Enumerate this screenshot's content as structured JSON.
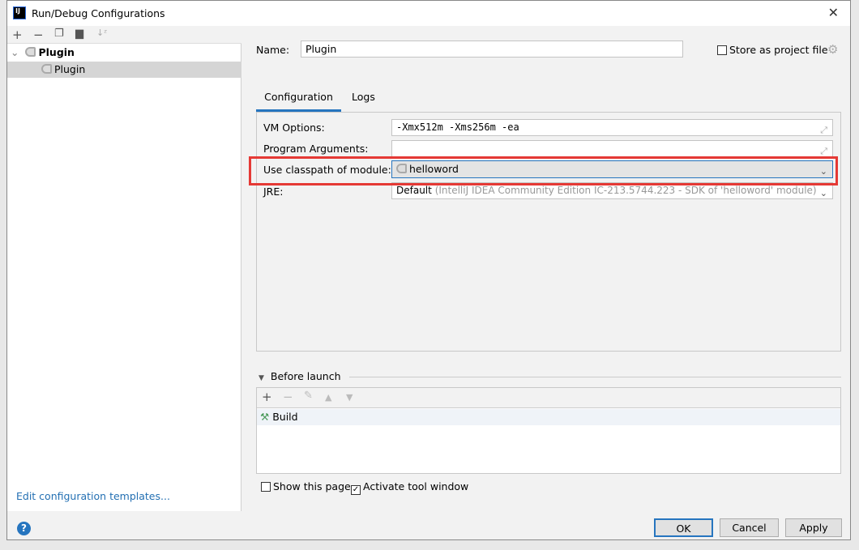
{
  "window": {
    "title": "Run/Debug Configurations",
    "logo": "IJ",
    "close_icon": "close-icon"
  },
  "tree": {
    "group": "Plugin",
    "item": "Plugin"
  },
  "left_footer": {
    "templates_link": "Edit configuration templates..."
  },
  "name": {
    "label": "Name:",
    "value": "Plugin"
  },
  "store": {
    "label": "Store as project file",
    "checked": false
  },
  "tabs": [
    {
      "label": "Configuration",
      "active": true
    },
    {
      "label": "Logs",
      "active": false
    }
  ],
  "config": {
    "vm_options": {
      "label": "VM Options:",
      "value": "-Xmx512m -Xms256m -ea"
    },
    "program_arguments": {
      "label": "Program Arguments:",
      "value": ""
    },
    "module": {
      "label": "Use classpath of module:",
      "value": "helloword"
    },
    "jre": {
      "label": "JRE:",
      "value": "Default",
      "hint": "(IntelliJ IDEA Community Edition IC-213.5744.223 - SDK of 'helloword' module)"
    }
  },
  "before_launch": {
    "title": "Before launch",
    "tasks": [
      "Build"
    ]
  },
  "options": {
    "show_page": {
      "label": "Show this page",
      "checked": false
    },
    "activate_tool": {
      "label": "Activate tool window",
      "checked": true
    }
  },
  "buttons": {
    "ok": "OK",
    "cancel": "Cancel",
    "apply": "Apply"
  },
  "colors": {
    "highlight": "#e53935",
    "accent": "#2675bf",
    "link": "#2470b3"
  }
}
